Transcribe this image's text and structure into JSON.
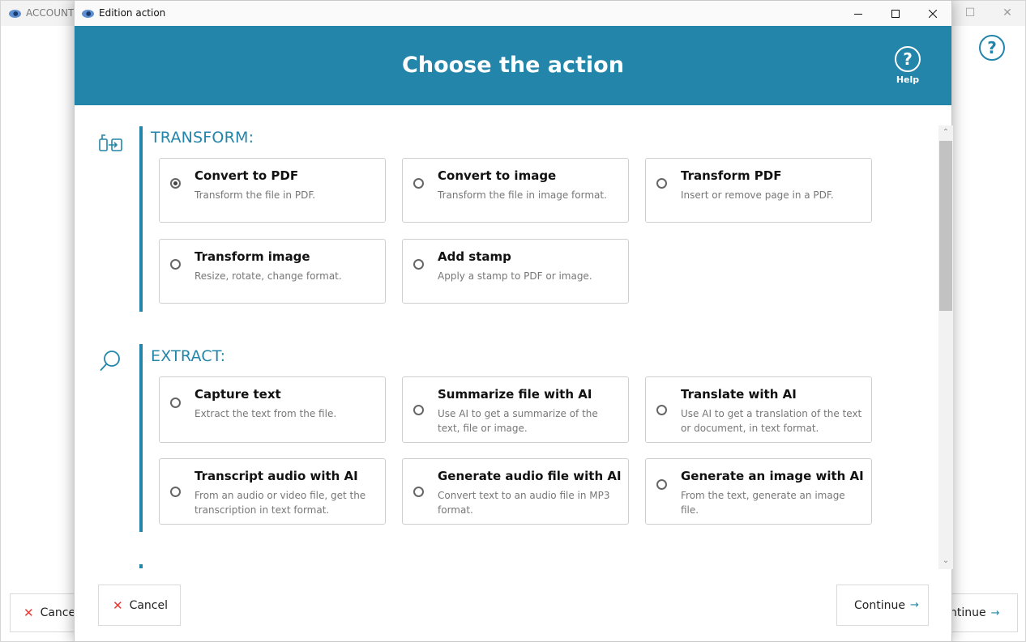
{
  "background_window": {
    "title": "ACCOUNT",
    "help_glyph": "?",
    "cancel_label": "Cancel",
    "continue_label": "ntinue"
  },
  "modal": {
    "title": "Edition action",
    "header_title": "Choose the action",
    "help_glyph": "?",
    "help_label": "Help",
    "accent_color": "#2385a9"
  },
  "sections": [
    {
      "title": "TRANSFORM:",
      "icon": "transform-icon",
      "actions": [
        {
          "title": "Convert to PDF",
          "desc": "Transform the file in PDF.",
          "selected": true
        },
        {
          "title": "Convert to image",
          "desc": "Transform the file in image format.",
          "selected": false
        },
        {
          "title": "Transform PDF",
          "desc": "Insert or remove page in a PDF.",
          "selected": false
        },
        {
          "title": "Transform image",
          "desc": "Resize, rotate, change format.",
          "selected": false
        },
        {
          "title": "Add stamp",
          "desc": "Apply a stamp to PDF or image.",
          "selected": false
        }
      ]
    },
    {
      "title": "EXTRACT:",
      "icon": "search-icon",
      "actions": [
        {
          "title": "Capture text",
          "desc": "Extract the text from the file.",
          "selected": false
        },
        {
          "title": "Summarize file with AI",
          "desc": "Use AI to get a summarize of the text, file or image.",
          "selected": false
        },
        {
          "title": "Translate with AI",
          "desc": "Use AI to get a translation of the text or document, in text format.",
          "selected": false
        },
        {
          "title": "Transcript audio with AI",
          "desc": "From an audio or video file, get the transcription in text format.",
          "selected": false
        },
        {
          "title": "Generate audio file with AI",
          "desc": "Convert text to an audio file in MP3 format.",
          "selected": false
        },
        {
          "title": "Generate an image with AI",
          "desc": "From the text, generate an image file.",
          "selected": false
        }
      ]
    }
  ],
  "footer": {
    "cancel_label": "Cancel",
    "continue_label": "Continue"
  }
}
